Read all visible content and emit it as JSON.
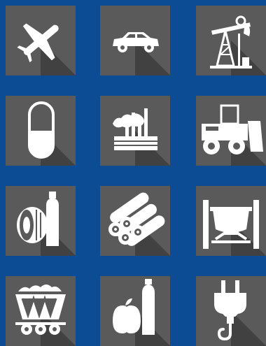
{
  "colors": {
    "background": "#0b4c95",
    "tile": "#5a5a5a",
    "icon": "#ffffff"
  },
  "tiles": [
    {
      "icon": "airplane-icon"
    },
    {
      "icon": "car-icon"
    },
    {
      "icon": "oil-pump-icon"
    },
    {
      "icon": "pill-capsule-icon"
    },
    {
      "icon": "factory-icon"
    },
    {
      "icon": "bulldozer-icon"
    },
    {
      "icon": "textile-bottle-icon"
    },
    {
      "icon": "timber-logs-icon"
    },
    {
      "icon": "steel-ladle-icon"
    },
    {
      "icon": "mine-cart-icon"
    },
    {
      "icon": "food-drink-icon"
    },
    {
      "icon": "electric-plug-icon"
    }
  ]
}
